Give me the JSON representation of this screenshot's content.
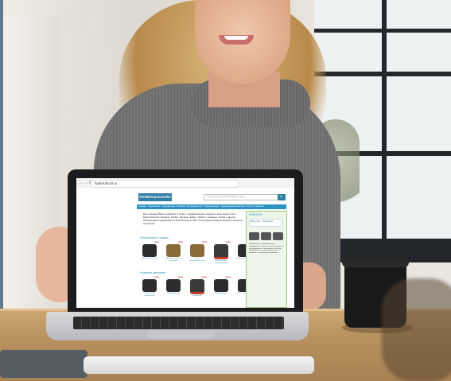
{
  "browser": {
    "nav_symbols": "← → C",
    "url": "hydraulic24.ru"
  },
  "site": {
    "logo": "HYDRAULIC24.RU",
    "search_placeholder": "Что ищете на этом сайте? Введите фразу...",
    "search_button": "🔍",
    "menu": [
      "Главная",
      "Гидронасосы",
      "Гидромоторы",
      "Клапаны",
      "Распределители",
      "Гидроцилиндры",
      "Гидравлические системы",
      "Услуги",
      "Контакты"
    ],
    "intro": "Мы поможем Вам подобрать и купить гидравлические изделия таких марок: Atos, Bosch Rexroth, Danfoss, Parker, Denison, Eaton, Vickers, Casappa, Hydac и других. Пересылаем гидравлику по всей России и СНГ. Популярные модели всегда в наличии на складе.",
    "section1": "Популярные товары",
    "section2": "Новинки магазина",
    "products_row1": [
      {
        "price": "Цена",
        "caption": "Гидравлический насос"
      },
      {
        "price": "Цена",
        "caption": "Гидромотор аксиально-поршневой"
      },
      {
        "price": "Цена",
        "caption": "Клапан предохранительный"
      },
      {
        "price": "Цена",
        "caption": "Распределитель гидравлический"
      },
      {
        "price": "Цена",
        "caption": "Гидроклапан давления"
      }
    ],
    "products_row2": [
      {
        "price": "Цена",
        "caption": "Гидронасос шестеренный"
      },
      {
        "price": "Цена",
        "caption": "Гидроаккумулятор"
      },
      {
        "price": "Цена",
        "caption": "Гидромотор"
      },
      {
        "price": "Цена",
        "caption": "Распределитель"
      },
      {
        "price": "Цена",
        "caption": "Насос пластинчатый"
      }
    ],
    "sidebar": {
      "title": "НОВОСТИ",
      "widget": "ВКонтакте · Hydraulic24",
      "text": "Новый каталог гидравлического оборудования: насосы, моторы, клапаны и распределители с доставкой по России. Подпишитесь на нашу группу, чтобы узнавать о поступлениях первыми."
    }
  }
}
